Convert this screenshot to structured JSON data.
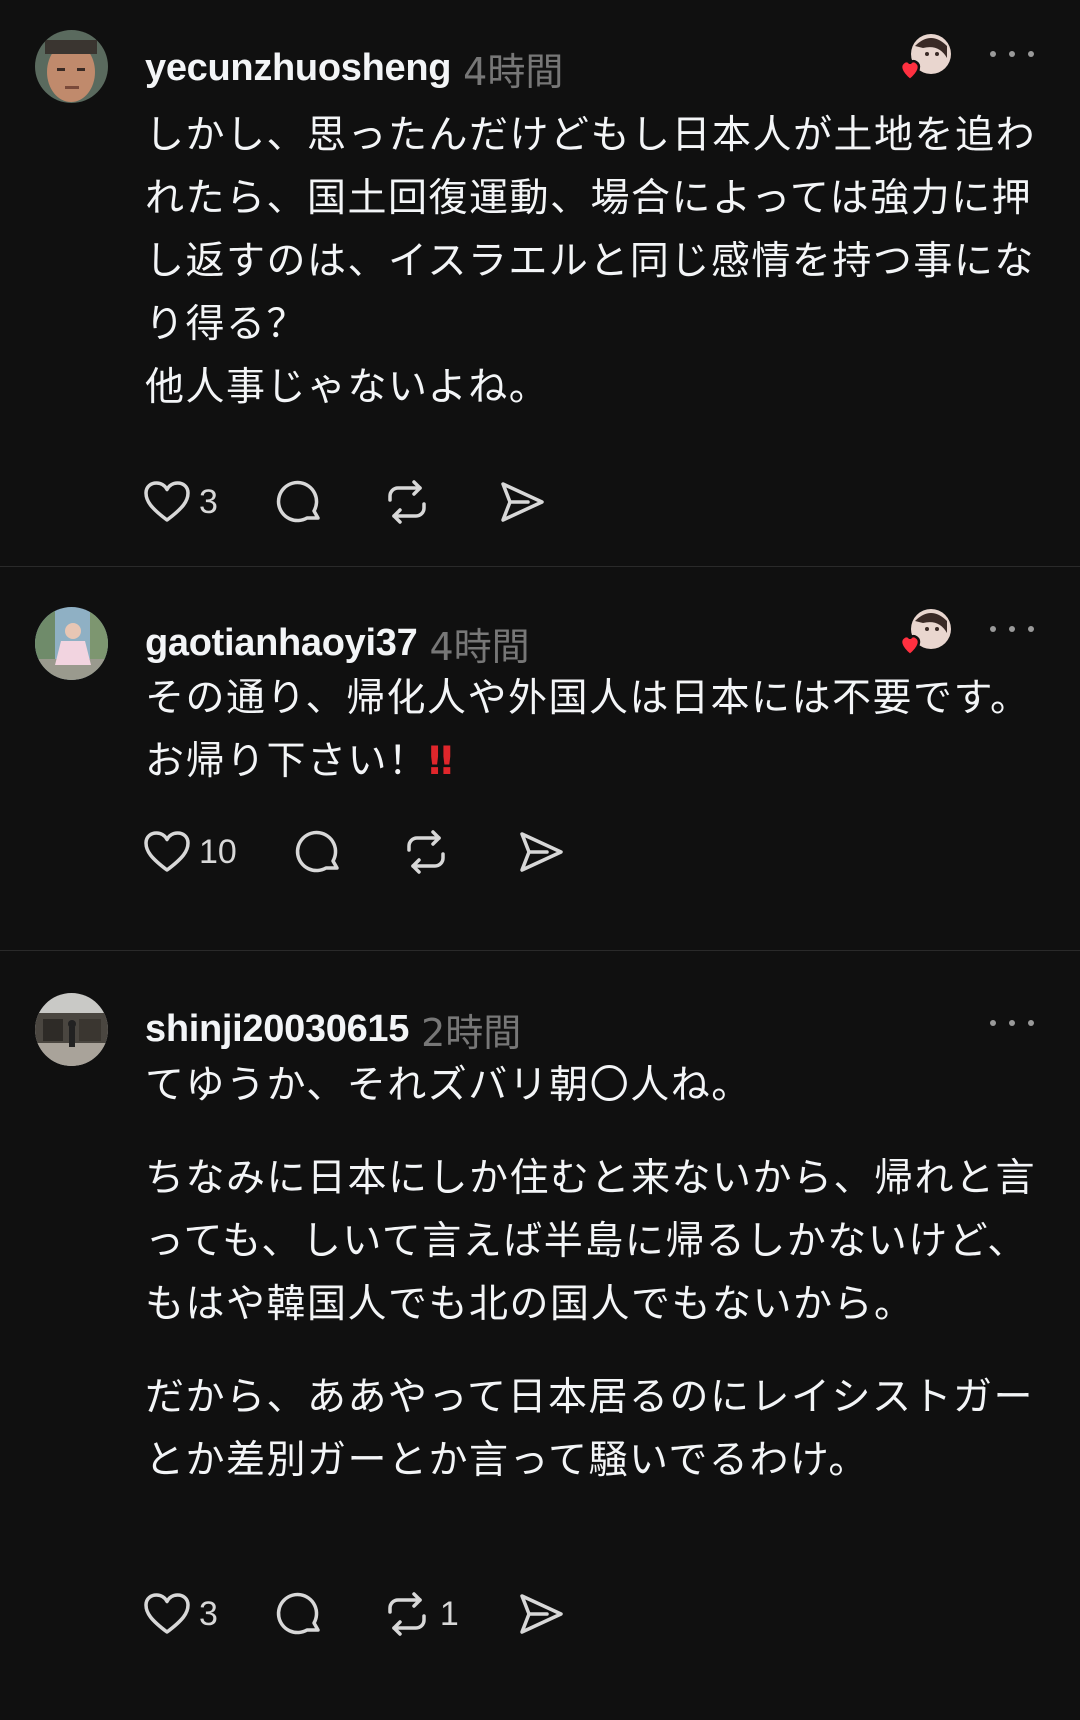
{
  "posts": [
    {
      "username": "yecunzhuosheng",
      "time": "4時間",
      "paragraphs": [
        "しかし、思ったんだけどもし日本人が土地を追われたら、国土回復運動、場合によっては強力に押し返すのは、イスラエルと同じ感情を持つ事になり得る？\n他人事じゃないよね。"
      ],
      "like_count": "3",
      "repost_count": "",
      "avatar_icon": "user-avatar-photo",
      "liker_icon": "liked-by-creator-avatar",
      "accent_heart": "#ff3040"
    },
    {
      "username": "gaotianhaoyi37",
      "time": "4時間",
      "paragraphs": [
        "その通り、帰化人や外国人は日本には不要です。お帰り下さい！"
      ],
      "emoji": "‼",
      "like_count": "10",
      "repost_count": ""
    },
    {
      "username": "shinji20030615",
      "time": "2時間",
      "paragraphs": [
        "てゆうか、それズバリ朝〇人ね。",
        "ちなみに日本にしか住むと来ないから、帰れと言っても、しいて言えば半島に帰るしかないけど、もはや韓国人でも北の国人でもないから。",
        "だから、ああやって日本居るのにレイシストガーとか差別ガーとか言って騒いでるわけ。"
      ],
      "like_count": "3",
      "repost_count": "1"
    }
  ],
  "colors": {
    "background": "#101010",
    "text": "#f3f5f7",
    "secondary_text": "#777777",
    "divider": "#2a2a2a",
    "heart": "#ff3040"
  }
}
